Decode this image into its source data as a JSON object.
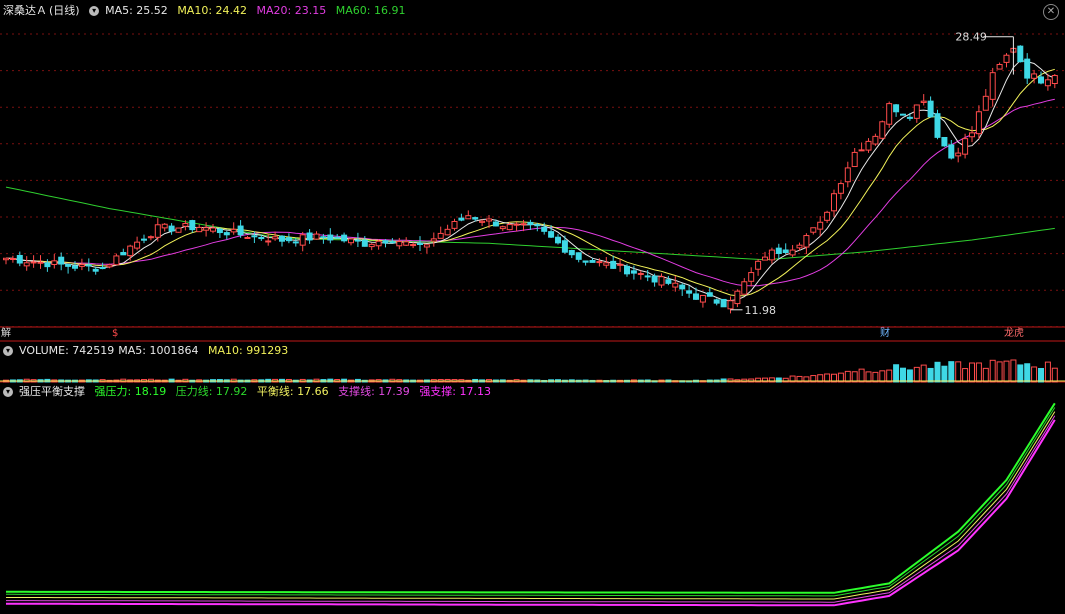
{
  "colors": {
    "up": "#ff4b4b",
    "down": "#3fd8e6",
    "ma5": "#e8e8e8",
    "ma10": "#f2f25a",
    "ma20": "#e23de2",
    "ma60": "#2fd02f",
    "grid": "#7a1010",
    "separator": "#c01818",
    "strong_pressure": "#2cff2c",
    "pressure_line": "#2cd82c",
    "balance_line": "#f0f060",
    "support_line": "#e24ae2",
    "strong_support": "#ff33ff"
  },
  "main_panel": {
    "stock": "深桑达Ａ",
    "period": "(日线)",
    "ma5": "MA5: 25.52",
    "ma10": "MA10: 24.42",
    "ma20": "MA20: 23.15",
    "ma60": "MA60: 16.91",
    "high_label": "28.49",
    "low_label": "11.98",
    "markers": [
      "解",
      "$",
      "财",
      "龙虎"
    ]
  },
  "volume_panel": {
    "volume": "VOLUME: 742519",
    "ma5": "MA5: 1001864",
    "ma10": "MA10: 991293"
  },
  "indicator_panel": {
    "name": "强压平衡支撑",
    "strong_pressure": "强压力: 18.19",
    "pressure_line": "压力线: 17.92",
    "balance_line": "平衡线: 17.66",
    "support_line": "支撑线: 17.39",
    "strong_support": "强支撑: 17.13"
  },
  "chart_data": {
    "type": "candlestick",
    "ohlc_anchors": [
      [
        0,
        15.1
      ],
      [
        10,
        14.6
      ],
      [
        14,
        14.5
      ],
      [
        18,
        15.8
      ],
      [
        22,
        16.9
      ],
      [
        28,
        17.0
      ],
      [
        33,
        16.6
      ],
      [
        40,
        16.2
      ],
      [
        46,
        16.4
      ],
      [
        52,
        16.0
      ],
      [
        56,
        16.3
      ],
      [
        60,
        15.7
      ],
      [
        63,
        16.6
      ],
      [
        67,
        17.7
      ],
      [
        73,
        17.0
      ],
      [
        77,
        16.9
      ],
      [
        83,
        15.1
      ],
      [
        90,
        14.4
      ],
      [
        96,
        13.6
      ],
      [
        100,
        12.8
      ],
      [
        104,
        12.4
      ],
      [
        106,
        13.0
      ],
      [
        110,
        15.3
      ],
      [
        114,
        15.8
      ],
      [
        118,
        17.1
      ],
      [
        120,
        19.0
      ],
      [
        123,
        21.5
      ],
      [
        126,
        22.6
      ],
      [
        128,
        24.3
      ],
      [
        131,
        23.8
      ],
      [
        133,
        24.8
      ],
      [
        135,
        22.6
      ],
      [
        137,
        21.2
      ],
      [
        140,
        22.7
      ],
      [
        143,
        26.1
      ],
      [
        146,
        27.9
      ],
      [
        148,
        26.2
      ],
      [
        150,
        25.9
      ],
      [
        152,
        26.3
      ]
    ],
    "volume_anchors": [
      [
        0,
        0.12
      ],
      [
        60,
        0.12
      ],
      [
        100,
        0.08
      ],
      [
        110,
        0.2
      ],
      [
        118,
        0.35
      ],
      [
        122,
        0.6
      ],
      [
        130,
        0.75
      ],
      [
        140,
        0.9
      ],
      [
        146,
        1.0
      ],
      [
        152,
        0.85
      ]
    ],
    "ma60_anchors": [
      [
        0,
        19.4
      ],
      [
        15,
        18.1
      ],
      [
        40,
        16.3
      ],
      [
        70,
        16.0
      ],
      [
        90,
        15.5
      ],
      [
        110,
        15.0
      ],
      [
        125,
        15.5
      ],
      [
        140,
        16.2
      ],
      [
        152,
        16.9
      ]
    ],
    "indicator": {
      "strong_pressure": [
        [
          0,
          6.16
        ],
        [
          120,
          6.1
        ],
        [
          128,
          6.7
        ],
        [
          138,
          10.0
        ],
        [
          145,
          13.3
        ],
        [
          152,
          18.19
        ]
      ],
      "pressure_line": [
        [
          0,
          6.0
        ],
        [
          120,
          5.9
        ],
        [
          128,
          6.5
        ],
        [
          138,
          9.7
        ],
        [
          145,
          13.0
        ],
        [
          152,
          17.92
        ]
      ],
      "balance_line": [
        [
          0,
          5.8
        ],
        [
          120,
          5.7
        ],
        [
          128,
          6.3
        ],
        [
          138,
          9.4
        ],
        [
          145,
          12.7
        ],
        [
          152,
          17.66
        ]
      ],
      "support_line": [
        [
          0,
          5.6
        ],
        [
          120,
          5.5
        ],
        [
          128,
          6.1
        ],
        [
          138,
          9.1
        ],
        [
          145,
          12.4
        ],
        [
          152,
          17.39
        ]
      ],
      "strong_support": [
        [
          0,
          5.4
        ],
        [
          120,
          5.3
        ],
        [
          128,
          5.9
        ],
        [
          138,
          8.8
        ],
        [
          145,
          12.1
        ],
        [
          152,
          17.13
        ]
      ]
    },
    "ylim": [
      11.0,
      29.5
    ]
  }
}
